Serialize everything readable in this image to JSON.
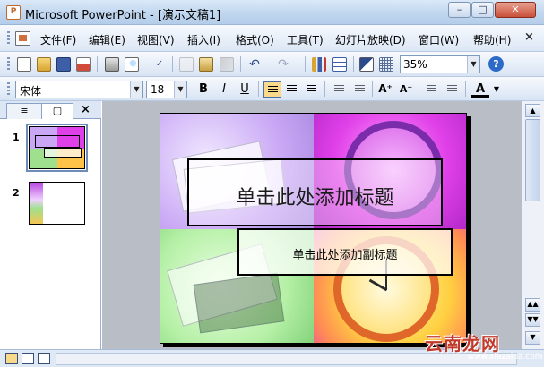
{
  "window": {
    "title": "Microsoft PowerPoint - [演示文稿1]",
    "controls": {
      "minimize": "–",
      "maximize": "□",
      "close": "✕"
    }
  },
  "menubar": {
    "items": [
      "文件(F)",
      "编辑(E)",
      "视图(V)",
      "插入(I)",
      "格式(O)",
      "工具(T)",
      "幻灯片放映(D)",
      "窗口(W)",
      "帮助(H)"
    ],
    "close_glyph": "×"
  },
  "standard_toolbar": {
    "icons": [
      "new-icon",
      "open-icon",
      "save-icon",
      "permission-icon",
      "print-icon",
      "print-preview-icon",
      "spelling-icon",
      "cut-icon",
      "copy-icon",
      "paste-icon",
      "format-painter-icon",
      "undo-icon",
      "redo-icon",
      "insert-chart-icon",
      "insert-table-icon",
      "color-grayscale-icon",
      "show-grid-icon"
    ],
    "zoom": {
      "value": "35%",
      "dropdown_glyph": "▼"
    },
    "help_glyph": "?"
  },
  "format_toolbar": {
    "font": "宋体",
    "size": "18",
    "bold": "B",
    "italic": "I",
    "underline": "U",
    "increase_font": "A⁺",
    "decrease_font": "A⁻",
    "font_color": "A",
    "dropdown_glyph": "▼",
    "align_left_active": true
  },
  "panel": {
    "tabs": [
      {
        "label": "≡",
        "name": "outline"
      },
      {
        "label": "▢",
        "name": "slides"
      }
    ],
    "active_tab": "slides",
    "close_glyph": "×",
    "slides": [
      {
        "number": "1",
        "selected": true
      },
      {
        "number": "2",
        "selected": false
      }
    ]
  },
  "slide": {
    "title_placeholder": "单击此处添加标题",
    "subtitle_placeholder": "单击此处添加副标题"
  },
  "scrollbar": {
    "up": "▲",
    "prev": "▲▲",
    "next": "▼▼",
    "down": "▼"
  },
  "watermark": {
    "text": "云南龙网",
    "subtext": "www.xiazaiba.com"
  }
}
